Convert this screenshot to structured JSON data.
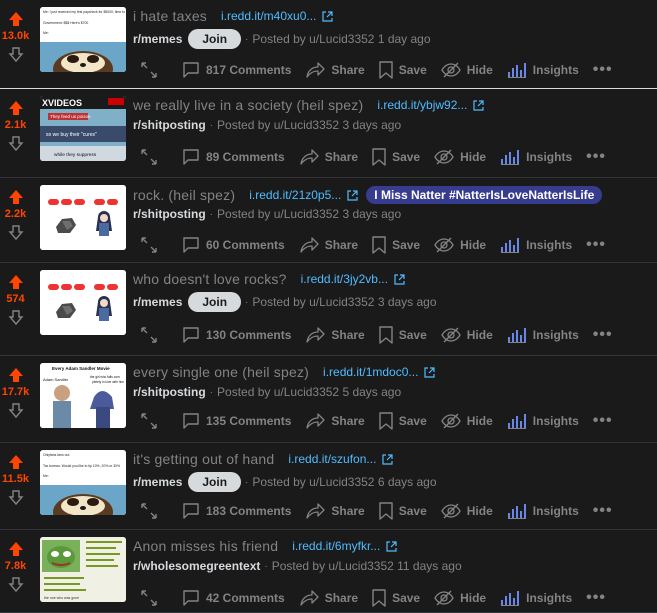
{
  "posts": [
    {
      "score": "13.0k",
      "title": "i hate taxes",
      "domain": "i.redd.it/m40xu0...",
      "flair": "",
      "subreddit": "r/memes",
      "join": "Join",
      "posted_by": "Posted by u/Lucid3352 1 day ago",
      "comments": "817 Comments",
      "thumb": "tanuki-tax"
    },
    {
      "score": "2.1k",
      "title": "we really live in a society (heil spez)",
      "domain": "i.redd.it/ybjw92...",
      "flair": "",
      "subreddit": "r/shitposting",
      "join": "",
      "posted_by": "Posted by u/Lucid3352 3 days ago",
      "comments": "89 Comments",
      "thumb": "xvideos"
    },
    {
      "score": "2.2k",
      "title": "rock. (heil spez)",
      "domain": "i.redd.it/21z0p5...",
      "flair": "I Miss Natter #NatterIsLoveNatterIsLife",
      "subreddit": "r/shitposting",
      "join": "",
      "posted_by": "Posted by u/Lucid3352 3 days ago",
      "comments": "60 Comments",
      "thumb": "rock"
    },
    {
      "score": "574",
      "title": "who doesn't love rocks?",
      "domain": "i.redd.it/3jy2vb...",
      "flair": "",
      "subreddit": "r/memes",
      "join": "Join",
      "posted_by": "Posted by u/Lucid3352 3 days ago",
      "comments": "130 Comments",
      "thumb": "rock"
    },
    {
      "score": "17.7k",
      "title": "every single one (heil spez)",
      "domain": "i.redd.it/1mdoc0...",
      "flair": "",
      "subreddit": "r/shitposting",
      "join": "",
      "posted_by": "Posted by u/Lucid3352 5 days ago",
      "comments": "135 Comments",
      "thumb": "sandler"
    },
    {
      "score": "11.5k",
      "title": "it's getting out of hand",
      "domain": "i.redd.it/szufon...",
      "flair": "",
      "subreddit": "r/memes",
      "join": "Join",
      "posted_by": "Posted by u/Lucid3352 6 days ago",
      "comments": "183 Comments",
      "thumb": "tanuki-hand"
    },
    {
      "score": "7.8k",
      "title": "Anon misses his friend",
      "domain": "i.redd.it/6myfkr...",
      "flair": "",
      "subreddit": "r/wholesomegreentext",
      "join": "",
      "posted_by": "Posted by u/Lucid3352 11 days ago",
      "comments": "42 Comments",
      "thumb": "greentext"
    }
  ],
  "labels": {
    "share": "Share",
    "save": "Save",
    "hide": "Hide",
    "insights": "Insights",
    "more": "•••"
  },
  "thumb_text": {
    "tanuki_tax_top": "Me: I just received my first paycheck for $5000, time to celebrate!",
    "tanuki_tax_line2": "Government: $$$ Here's $700",
    "tanuki_tax_me": "Me:",
    "xvideos_logo": "XVIDEOS",
    "xvideos_line1": "They feed us poison",
    "xvideos_line2": "so we buy their \"cures\"",
    "xvideos_line3": "while they suppress",
    "sandler_title": "Every Adam Sandler Movie",
    "sandler_name": "Adam Sandler",
    "sandler_caption": "the girl who falls completely in love with him",
    "tanuki_hand_top": "Onlyfans fans out",
    "tanuki_hand_line2": "Tax bureau: Would you like to tip 10%, 20% or 30%",
    "tanuki_hand_me": "Me:",
    "greentext_bottom": "the one who was gone"
  },
  "colors": {
    "upvote": "#ff4500",
    "bg": "#1a1a1b",
    "link": "#4fbcff",
    "muted": "#818384"
  }
}
